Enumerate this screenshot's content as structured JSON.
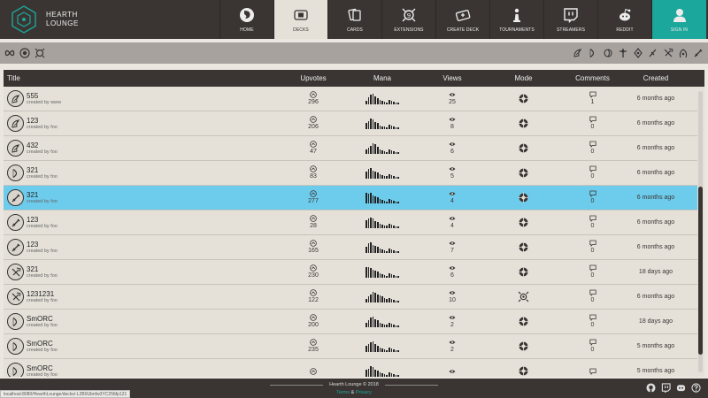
{
  "brand": {
    "name": "HEARTH\nLOUNGE"
  },
  "nav": [
    {
      "label": "HOME",
      "icon": "home-icon"
    },
    {
      "label": "DECKS",
      "icon": "decks-icon",
      "active": true
    },
    {
      "label": "CARDS",
      "icon": "cards-icon"
    },
    {
      "label": "EXTENSIONS",
      "icon": "extensions-icon"
    },
    {
      "label": "CREATE DECK",
      "icon": "create-deck-icon"
    },
    {
      "label": "TOURNAMENTS",
      "icon": "tournaments-icon"
    },
    {
      "label": "STREAMERS",
      "icon": "twitch-icon"
    },
    {
      "label": "REDDIT",
      "icon": "reddit-icon"
    },
    {
      "label": "SIGN IN",
      "icon": "user-icon"
    }
  ],
  "colors": {
    "dark": "#3a3532",
    "accent": "#1ba79b",
    "selected": "#6dcbeb",
    "background": "#ebe7e0"
  },
  "table": {
    "headers": {
      "title": "Title",
      "upvotes": "Upvotes",
      "mana": "Mana",
      "views": "Views",
      "mode": "Mode",
      "comments": "Comments",
      "created": "Created"
    },
    "rows": [
      {
        "name": "555",
        "author": "created by www",
        "upvotes": "296",
        "views": "25",
        "comments": "1",
        "created": "6 months ago",
        "hero": "druid",
        "mode": "standard"
      },
      {
        "name": "123",
        "author": "created by foo",
        "upvotes": "206",
        "views": "8",
        "comments": "0",
        "created": "6 months ago",
        "hero": "druid",
        "mode": "standard"
      },
      {
        "name": "432",
        "author": "created by foo",
        "upvotes": "47",
        "views": "6",
        "comments": "0",
        "created": "6 months ago",
        "hero": "druid",
        "mode": "standard"
      },
      {
        "name": "321",
        "author": "created by foo",
        "upvotes": "83",
        "views": "5",
        "comments": "0",
        "created": "6 months ago",
        "hero": "hunter",
        "mode": "standard"
      },
      {
        "name": "321",
        "author": "created by foo",
        "upvotes": "277",
        "views": "4",
        "comments": "0",
        "created": "6 months ago",
        "hero": "warrior",
        "mode": "standard",
        "selected": true
      },
      {
        "name": "123",
        "author": "created by foo",
        "upvotes": "28",
        "views": "4",
        "comments": "0",
        "created": "6 months ago",
        "hero": "warrior",
        "mode": "standard"
      },
      {
        "name": "123",
        "author": "created by foo",
        "upvotes": "165",
        "views": "7",
        "comments": "0",
        "created": "6 months ago",
        "hero": "warrior",
        "mode": "standard"
      },
      {
        "name": "321",
        "author": "created by foo",
        "upvotes": "230",
        "views": "6",
        "comments": "0",
        "created": "18 days ago",
        "hero": "shaman",
        "mode": "standard"
      },
      {
        "name": "1231231",
        "author": "created by foo",
        "upvotes": "122",
        "views": "10",
        "comments": "0",
        "created": "6 months ago",
        "hero": "shaman",
        "mode": "wild"
      },
      {
        "name": "SmORC",
        "author": "created by foo",
        "upvotes": "200",
        "views": "2",
        "comments": "0",
        "created": "18 days ago",
        "hero": "hunter",
        "mode": "standard"
      },
      {
        "name": "SmORC",
        "author": "created by foo",
        "upvotes": "235",
        "views": "2",
        "comments": "0",
        "created": "5 months ago",
        "hero": "hunter",
        "mode": "standard"
      },
      {
        "name": "SmORC",
        "author": "created by foo",
        "upvotes": "",
        "views": "",
        "comments": "",
        "created": "5 months ago",
        "hero": "hunter",
        "mode": "standard"
      }
    ]
  },
  "footer": {
    "copyright": "Hearth Lounge © 2018",
    "terms": "Terms",
    "amp": "&",
    "privacy": "Privacy"
  },
  "status_url": "localhost:8080/HearthLounge/decks/-L2B0Ubnfw3YC25Mp121"
}
